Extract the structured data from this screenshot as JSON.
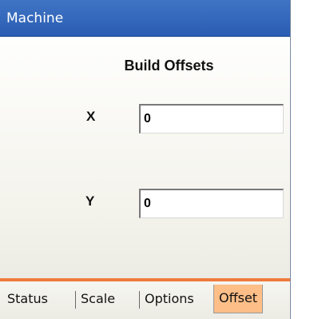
{
  "window": {
    "title": "Machine"
  },
  "offsets": {
    "heading": "Build Offsets",
    "x_label": "X",
    "x_value": "0",
    "y_label": "Y",
    "y_value": "0"
  },
  "tabs": [
    {
      "label": "Status",
      "active": false
    },
    {
      "label": "Scale",
      "active": false
    },
    {
      "label": "Options",
      "active": false
    },
    {
      "label": "Offset",
      "active": true
    }
  ],
  "colors": {
    "title_bar": "#2a5db3",
    "active_tab": "#fdbe88",
    "tab_accent_line": "#ef7b3e"
  }
}
